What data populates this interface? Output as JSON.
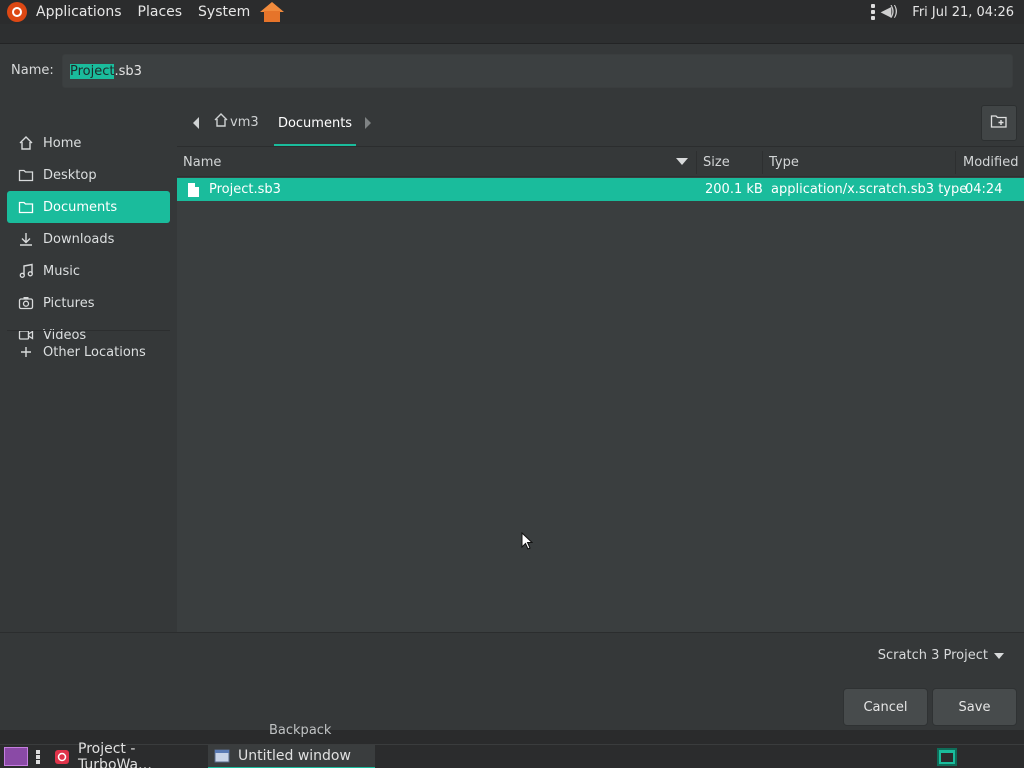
{
  "top_panel": {
    "menus": [
      "Applications",
      "Places",
      "System"
    ],
    "clock": "Fri Jul 21, 04:26"
  },
  "dialog": {
    "name_label": "Name:",
    "name_value": {
      "selected": "Project",
      "rest": ".sb3"
    },
    "sidebar": {
      "items": [
        {
          "label": "Home",
          "icon": "home-icon",
          "active": false
        },
        {
          "label": "Desktop",
          "icon": "folder-icon",
          "active": false
        },
        {
          "label": "Documents",
          "icon": "folder-icon",
          "active": true
        },
        {
          "label": "Downloads",
          "icon": "download-icon",
          "active": false
        },
        {
          "label": "Music",
          "icon": "music-icon",
          "active": false
        },
        {
          "label": "Pictures",
          "icon": "camera-icon",
          "active": false
        },
        {
          "label": "Videos",
          "icon": "video-icon",
          "active": false
        }
      ],
      "other_locations": "Other Locations"
    },
    "pathbar": {
      "home_segment": "vm3",
      "current_segment": "Documents"
    },
    "columns": {
      "name": "Name",
      "size": "Size",
      "type": "Type",
      "modified": "Modified"
    },
    "files": [
      {
        "name": "Project.sb3",
        "size": "200.1 kB",
        "type": "application/x.scratch.sb3 type",
        "modified": "04:24",
        "selected": true
      }
    ],
    "filter": "Scratch 3 Project",
    "cancel_label": "Cancel",
    "save_label": "Save"
  },
  "background_app": {
    "backpack_label": "Backpack"
  },
  "taskbar": {
    "tasks": [
      {
        "label": "Project - TurboWa…",
        "icon": "turbowarp-icon",
        "active": false
      },
      {
        "label": "Untitled window",
        "icon": "window-icon",
        "active": true
      }
    ]
  },
  "colors": {
    "accent": "#1abc9c",
    "dialog_bg": "#353839",
    "panel_bg": "#2b2c2d"
  }
}
